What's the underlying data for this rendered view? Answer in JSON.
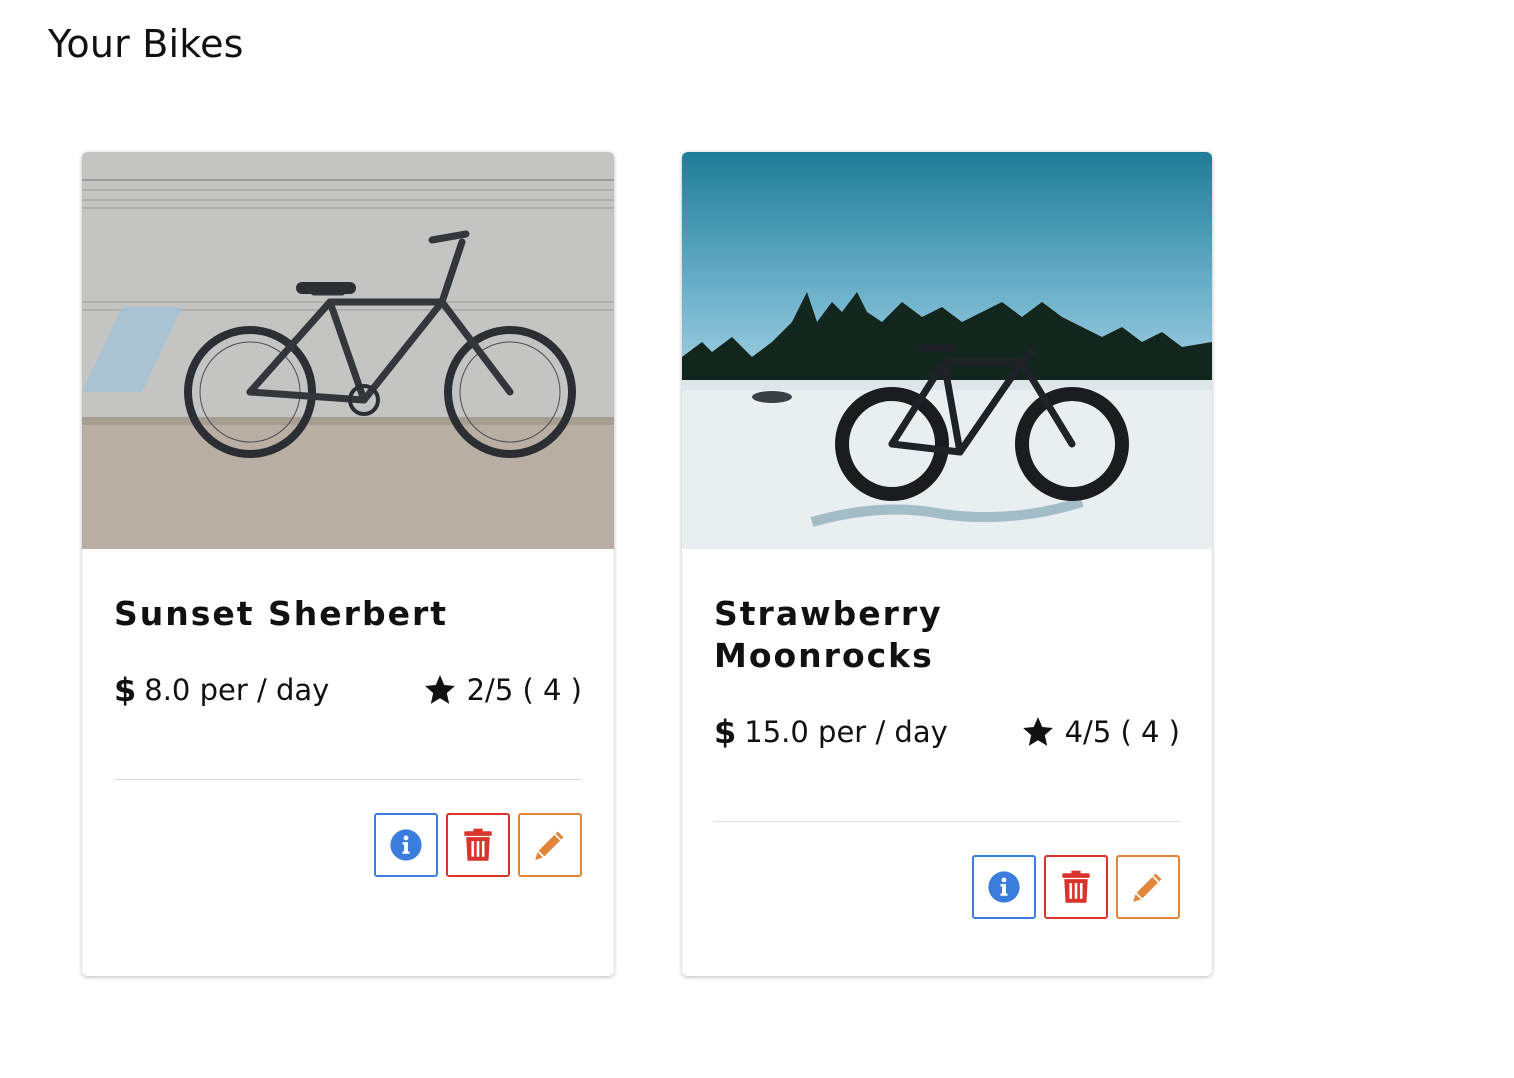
{
  "page": {
    "title": "Your Bikes"
  },
  "bikes": [
    {
      "name": "Sunset Sherbert",
      "currency_symbol": "$",
      "price_text": "8.0 per / day",
      "rating_text": "2/5 ( 4 )",
      "image": "city-bike-photo",
      "actions": [
        "info-icon",
        "trash-icon",
        "pencil-icon"
      ]
    },
    {
      "name": "Strawberry Moonrocks",
      "currency_symbol": "$",
      "price_text": "15.0 per / day",
      "rating_text": "4/5 ( 4 )",
      "image": "fat-bike-snow-photo",
      "actions": [
        "info-icon",
        "trash-icon",
        "pencil-icon"
      ]
    }
  ],
  "colors": {
    "info": "#3b7ddd",
    "delete": "#d9332b",
    "edit": "#e0853a"
  }
}
